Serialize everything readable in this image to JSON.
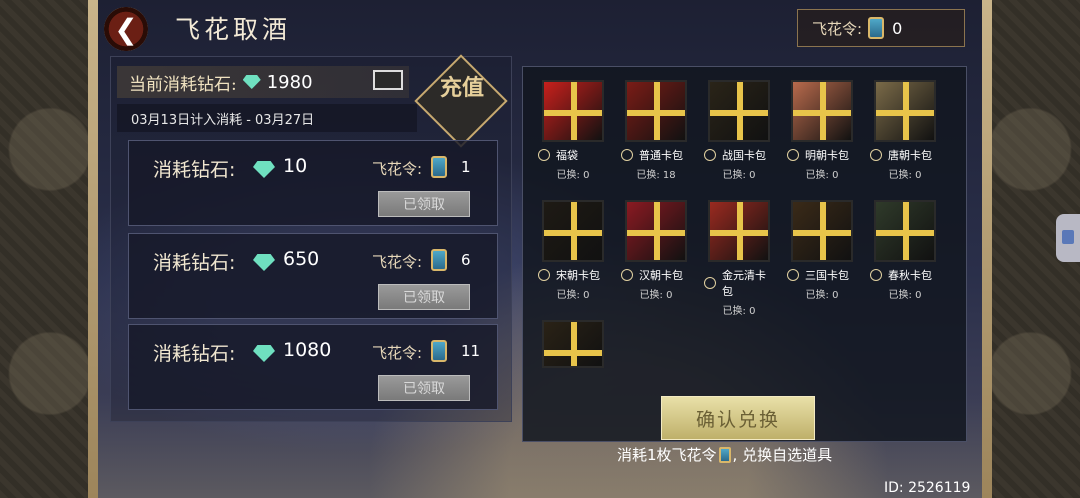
{
  "header": {
    "title": "飞花取酒",
    "back_icon": "chevron-left-icon",
    "token_label": "飞花令:",
    "token_count": "0"
  },
  "consumption": {
    "label": "当前消耗钻石:",
    "value": "1980",
    "date_range": "03月13日计入消耗 - 03月27日",
    "recharge_label": "充值"
  },
  "tiers": [
    {
      "label": "消耗钻石:",
      "value": "10",
      "token_label": "飞花令:",
      "token_count": "1",
      "button": "已领取"
    },
    {
      "label": "消耗钻石:",
      "value": "650",
      "token_label": "飞花令:",
      "token_count": "6",
      "button": "已领取"
    },
    {
      "label": "消耗钻石:",
      "value": "1080",
      "token_label": "飞花令:",
      "token_count": "11",
      "button": "已领取"
    }
  ],
  "items": [
    {
      "name": "福袋",
      "count": "已换: 0",
      "color": "#c8201c"
    },
    {
      "name": "普通卡包",
      "count": "已换: 18",
      "color": "#7a1c16"
    },
    {
      "name": "战国卡包",
      "count": "已换: 0",
      "color": "#2a2418"
    },
    {
      "name": "明朝卡包",
      "count": "已换: 0",
      "color": "#b86a4c"
    },
    {
      "name": "唐朝卡包",
      "count": "已换: 0",
      "color": "#7a6a48"
    },
    {
      "name": "宋朝卡包",
      "count": "已换: 0",
      "color": "#1e1a14"
    },
    {
      "name": "汉朝卡包",
      "count": "已换: 0",
      "color": "#8a1a22"
    },
    {
      "name": "金元清卡包",
      "count": "已换: 0",
      "color": "#9a2a20"
    },
    {
      "name": "三国卡包",
      "count": "已换: 0",
      "color": "#3a2a18"
    },
    {
      "name": "春秋卡包",
      "count": "已换: 0",
      "color": "#2f3a2a"
    },
    {
      "name": "",
      "count": "",
      "color": "#2a2216"
    }
  ],
  "confirm_label": "确认兑换",
  "footer": {
    "note_before": "消耗1枚飞花令",
    "note_after": ", 兑换自选道具"
  },
  "user_id": "ID: 2526119"
}
